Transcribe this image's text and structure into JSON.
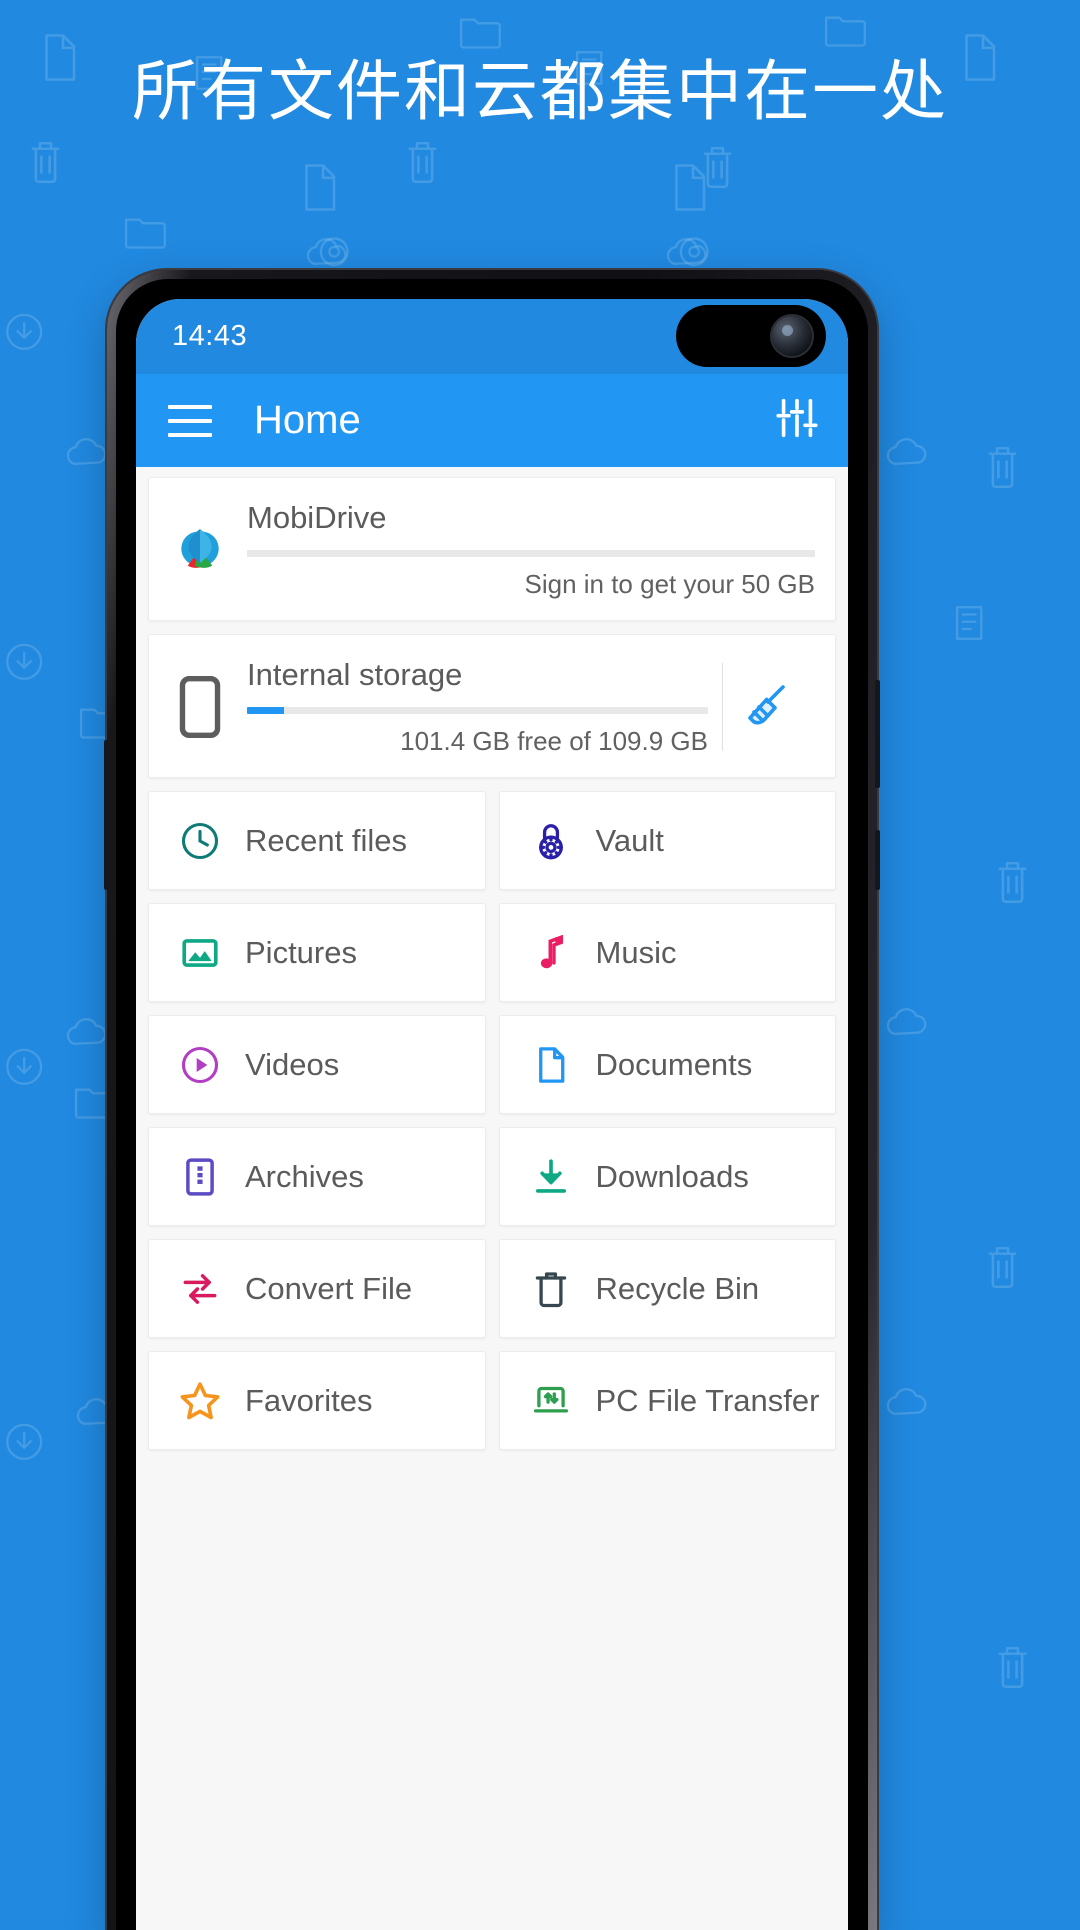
{
  "headline": "所有文件和云都集中在一处",
  "status_bar": {
    "time": "14:43",
    "signal_icon": "signal-bars-icon",
    "battery_icon": "battery-icon"
  },
  "app_bar": {
    "menu_icon": "hamburger-menu-icon",
    "title": "Home",
    "action_icon": "tune-settings-icon"
  },
  "drives": [
    {
      "name": "MobiDrive",
      "sub": "Sign in to get your 50 GB",
      "icon": "mobidrive-logo-icon",
      "progress": 0
    },
    {
      "name": "Internal storage",
      "sub": "101.4 GB free of 109.9 GB",
      "icon": "phone-storage-icon",
      "progress": 8,
      "action_icon": "broom-clean-icon"
    }
  ],
  "grid": [
    {
      "label": "Recent files",
      "icon": "clock-icon",
      "color": "#0f7b77"
    },
    {
      "label": "Vault",
      "icon": "padlock-icon",
      "color": "#2a1fa8"
    },
    {
      "label": "Pictures",
      "icon": "image-icon",
      "color": "#0fa884"
    },
    {
      "label": "Music",
      "icon": "music-note-icon",
      "color": "#e91e63"
    },
    {
      "label": "Videos",
      "icon": "play-circle-icon",
      "color": "#b23ec4"
    },
    {
      "label": "Documents",
      "icon": "document-icon",
      "color": "#2196f3"
    },
    {
      "label": "Archives",
      "icon": "archive-box-icon",
      "color": "#5b4cc4"
    },
    {
      "label": "Downloads",
      "icon": "download-icon",
      "color": "#0fa884"
    },
    {
      "label": "Convert File",
      "icon": "convert-arrows-icon",
      "color": "#d81b60"
    },
    {
      "label": "Recycle Bin",
      "icon": "trash-bin-icon",
      "color": "#37474f"
    },
    {
      "label": "Favorites",
      "icon": "star-icon",
      "color": "#f7941e"
    },
    {
      "label": "PC File Transfer",
      "icon": "pc-transfer-icon",
      "color": "#2e9e4f"
    }
  ],
  "colors": {
    "brand_blue": "#2189e0",
    "app_bar_blue": "#2196f3",
    "card_white": "#ffffff",
    "page_bg": "#f7f7f7",
    "text_gray": "#5b5b5b"
  }
}
